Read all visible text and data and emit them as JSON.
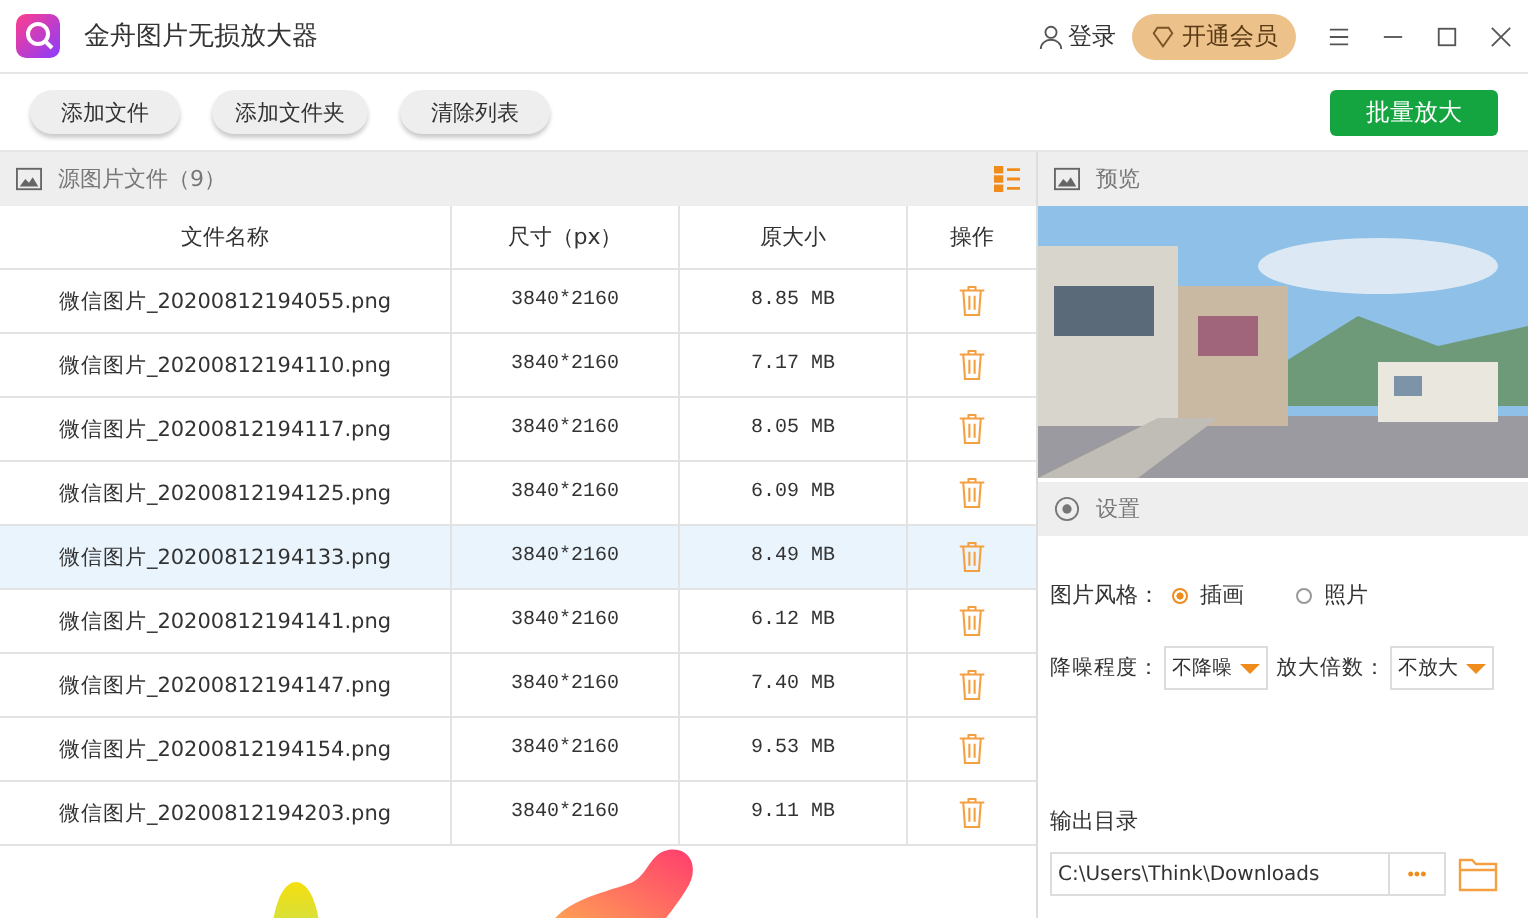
{
  "window": {
    "title": "金舟图片无损放大器",
    "login": "登录",
    "vip": "开通会员"
  },
  "toolbar": {
    "buttons": [
      "添加文件",
      "添加文件夹",
      "清除列表"
    ],
    "primary": "批量放大"
  },
  "files": {
    "title": "源图片文件（9）",
    "columns": [
      "文件名称",
      "尺寸（px）",
      "原大小",
      "操作"
    ],
    "rows": [
      {
        "name": "微信图片_20200812194055.png",
        "size": "3840*2160",
        "filesize": "8.85 MB",
        "selected": false
      },
      {
        "name": "微信图片_20200812194110.png",
        "size": "3840*2160",
        "filesize": "7.17 MB",
        "selected": false
      },
      {
        "name": "微信图片_20200812194117.png",
        "size": "3840*2160",
        "filesize": "8.05 MB",
        "selected": false
      },
      {
        "name": "微信图片_20200812194125.png",
        "size": "3840*2160",
        "filesize": "6.09 MB",
        "selected": false
      },
      {
        "name": "微信图片_20200812194133.png",
        "size": "3840*2160",
        "filesize": "8.49 MB",
        "selected": true
      },
      {
        "name": "微信图片_20200812194141.png",
        "size": "3840*2160",
        "filesize": "6.12 MB",
        "selected": false
      },
      {
        "name": "微信图片_20200812194147.png",
        "size": "3840*2160",
        "filesize": "7.40 MB",
        "selected": false
      },
      {
        "name": "微信图片_20200812194154.png",
        "size": "3840*2160",
        "filesize": "9.53 MB",
        "selected": false
      },
      {
        "name": "微信图片_20200812194203.png",
        "size": "3840*2160",
        "filesize": "9.11 MB",
        "selected": false
      }
    ]
  },
  "preview": {
    "title": "预览"
  },
  "settings": {
    "title": "设置",
    "style_label": "图片风格：",
    "styles": [
      {
        "label": "插画",
        "selected": true
      },
      {
        "label": "照片",
        "selected": false
      }
    ],
    "denoise_label": "降噪程度：",
    "denoise_value": "不降噪",
    "scale_label": "放大倍数：",
    "scale_value": "不放大",
    "output_label": "输出目录",
    "output_path": "C:\\Users\\Think\\Downloads",
    "browse": "•••"
  }
}
